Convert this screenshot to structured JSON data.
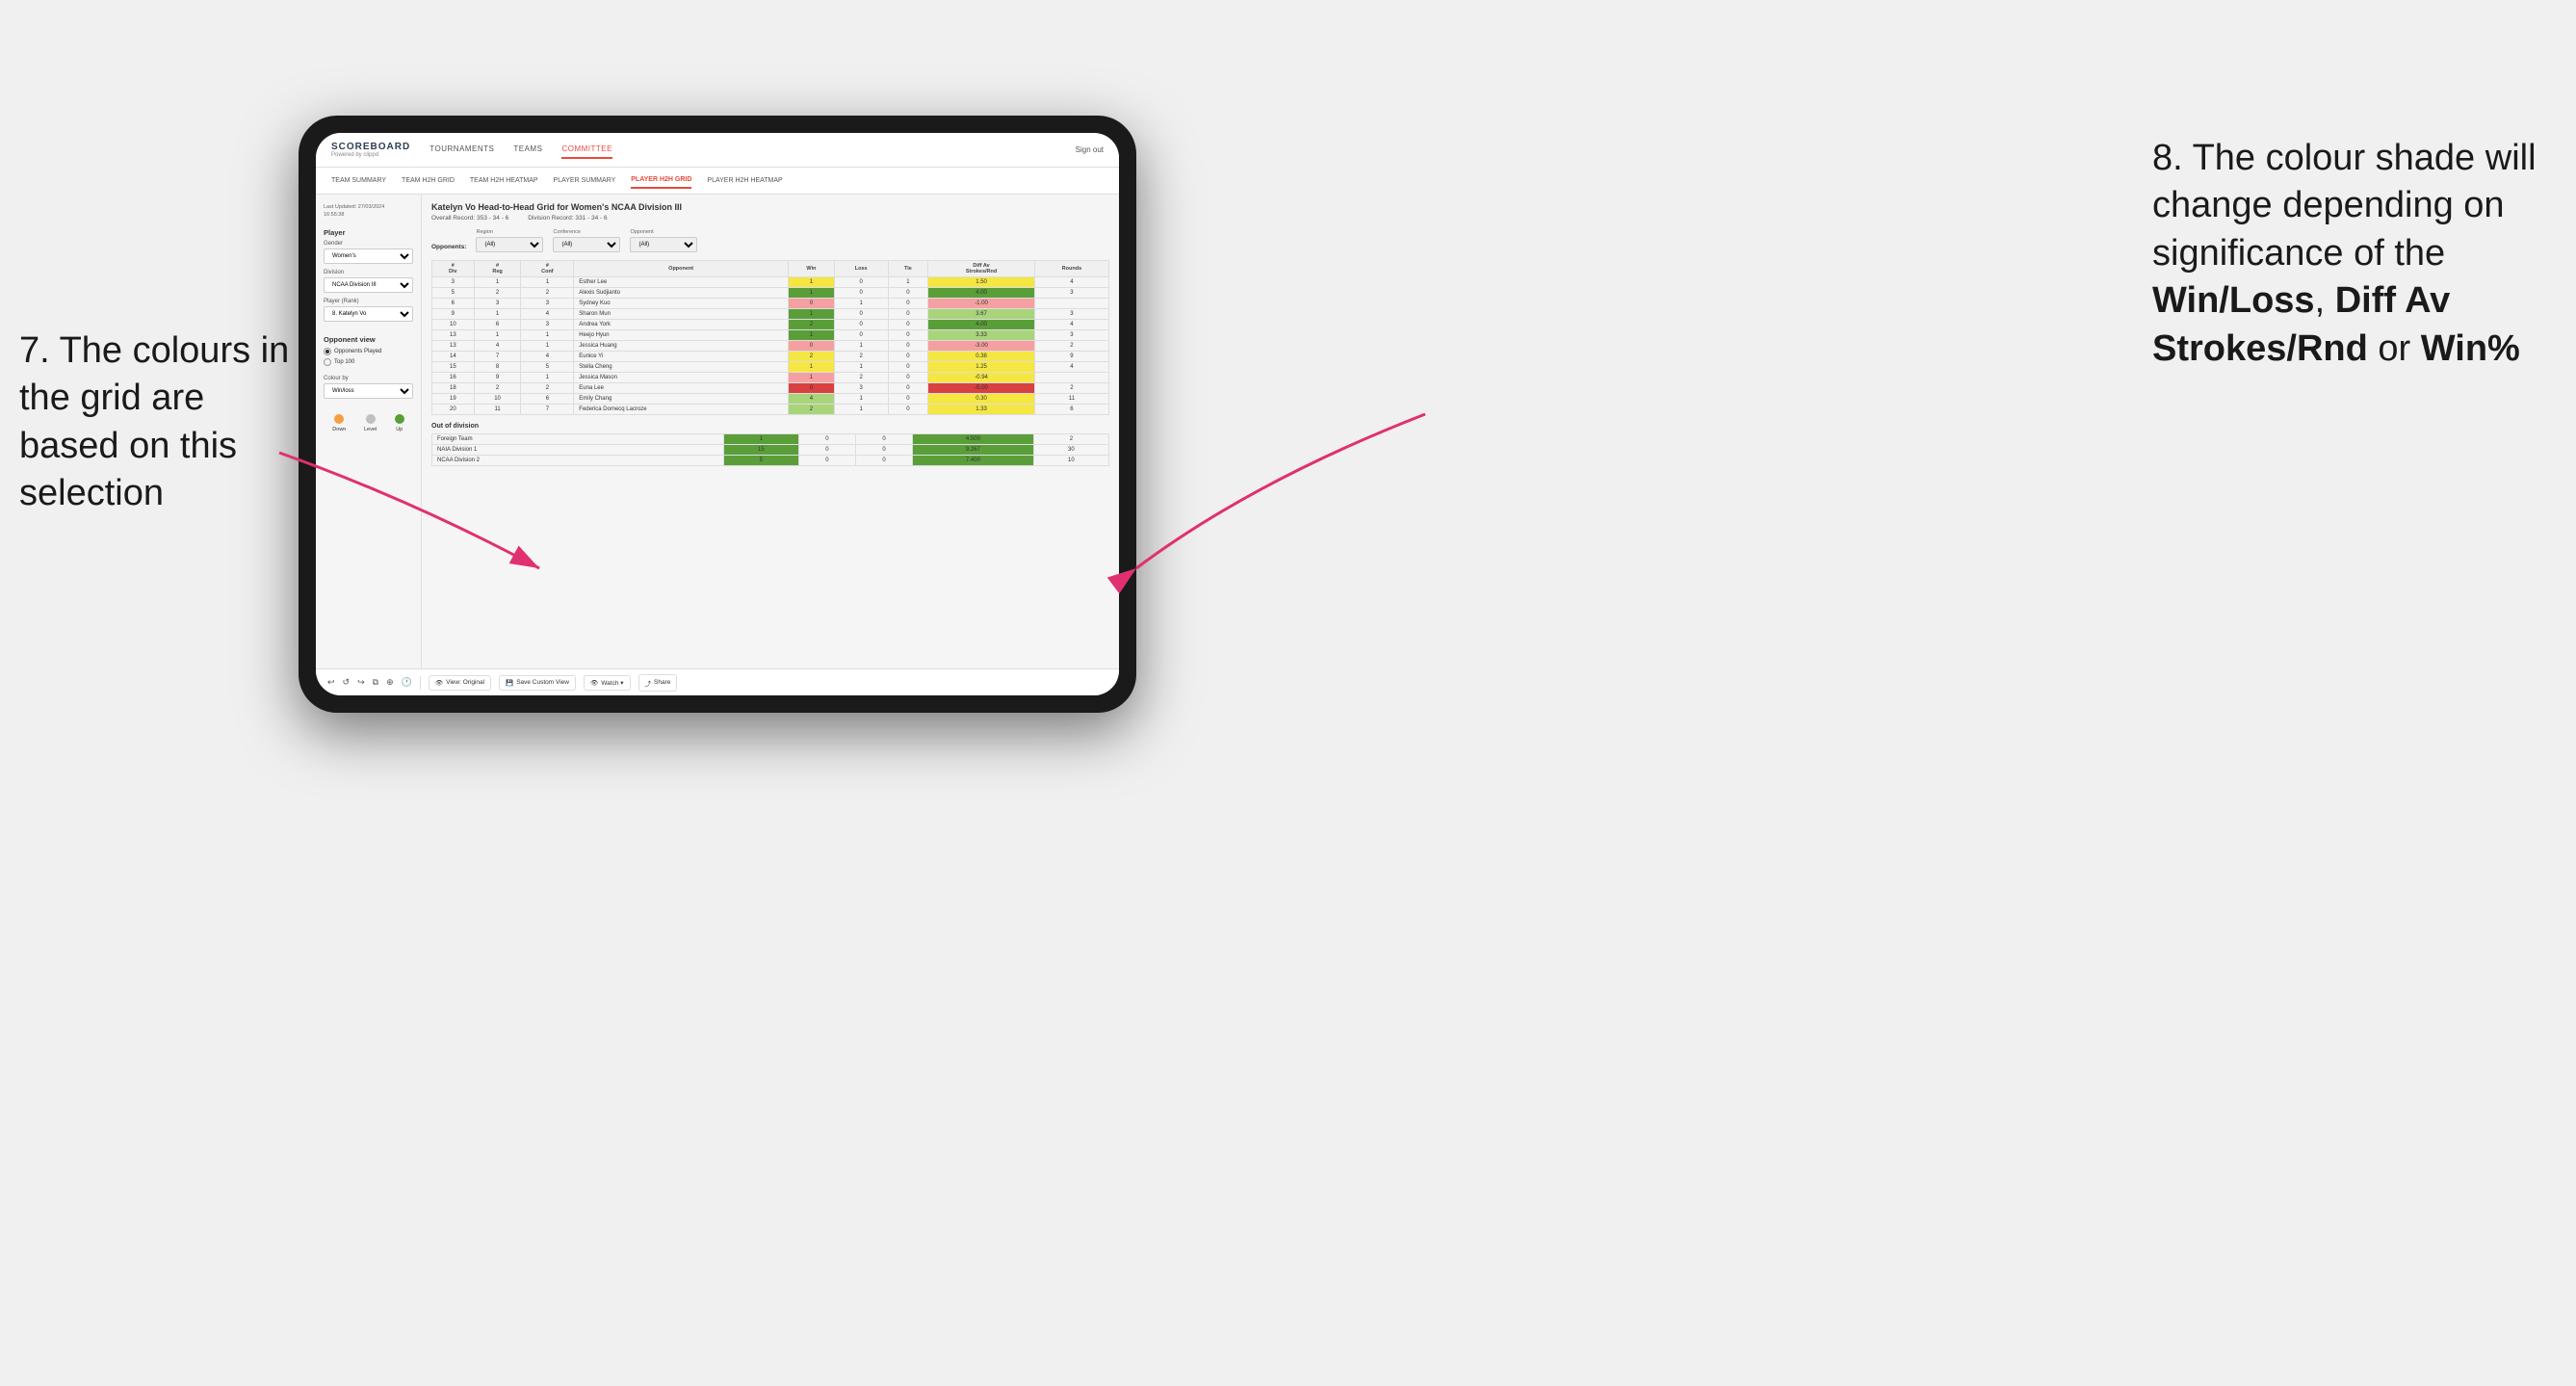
{
  "annotations": {
    "left_text": "7. The colours in the grid are based on this selection",
    "right_text_line1": "8. The colour shade will change depending on significance of the ",
    "right_bold1": "Win/Loss",
    "right_text_line2": ", ",
    "right_bold2": "Diff Av Strokes/Rnd",
    "right_text_line3": " or ",
    "right_bold3": "Win%"
  },
  "nav": {
    "logo": "SCOREBOARD",
    "logo_sub": "Powered by clippd",
    "links": [
      "TOURNAMENTS",
      "TEAMS",
      "COMMITTEE"
    ],
    "right": [
      "Sign out"
    ]
  },
  "sub_nav": {
    "links": [
      "TEAM SUMMARY",
      "TEAM H2H GRID",
      "TEAM H2H HEATMAP",
      "PLAYER SUMMARY",
      "PLAYER H2H GRID",
      "PLAYER H2H HEATMAP"
    ]
  },
  "sidebar": {
    "timestamp": "Last Updated: 27/03/2024\n16:55:38",
    "player_section": "Player",
    "gender_label": "Gender",
    "gender_value": "Women's",
    "division_label": "Division",
    "division_value": "NCAA Division III",
    "player_rank_label": "Player (Rank)",
    "player_rank_value": "8. Katelyn Vo",
    "opponent_view_label": "Opponent view",
    "radio_options": [
      "Opponents Played",
      "Top 100"
    ],
    "colour_by_label": "Colour by",
    "colour_by_value": "Win/loss",
    "legend": [
      {
        "label": "Down",
        "color": "#f5a040"
      },
      {
        "label": "Level",
        "color": "#c0c0c0"
      },
      {
        "label": "Up",
        "color": "#5a9e3a"
      }
    ]
  },
  "grid": {
    "title": "Katelyn Vo Head-to-Head Grid for Women's NCAA Division III",
    "overall_record_label": "Overall Record:",
    "overall_record_value": "353 - 34 - 6",
    "division_record_label": "Division Record:",
    "division_record_value": "331 - 34 - 6",
    "filters": {
      "opponents_label": "Opponents:",
      "region_label": "Region",
      "conference_label": "Conference",
      "opponent_label": "Opponent",
      "region_value": "(All)",
      "conference_value": "(All)",
      "opponent_value": "(All)"
    },
    "table_headers": [
      "#\nDiv",
      "#\nReg",
      "#\nConf",
      "Opponent",
      "Win",
      "Loss",
      "Tie",
      "Diff Av\nStrokes/Rnd",
      "Rounds"
    ],
    "rows": [
      {
        "div": "3",
        "reg": "1",
        "conf": "1",
        "opponent": "Esther Lee",
        "win": "1",
        "loss": "0",
        "tie": "1",
        "diff": "1.50",
        "rounds": "4",
        "win_color": "yellow",
        "diff_color": "yellow"
      },
      {
        "div": "5",
        "reg": "2",
        "conf": "2",
        "opponent": "Alexis Sudjianto",
        "win": "1",
        "loss": "0",
        "tie": "0",
        "diff": "4.00",
        "rounds": "3",
        "win_color": "green_dark",
        "diff_color": "green_dark"
      },
      {
        "div": "6",
        "reg": "3",
        "conf": "3",
        "opponent": "Sydney Kuo",
        "win": "0",
        "loss": "1",
        "tie": "0",
        "diff": "-1.00",
        "rounds": "",
        "win_color": "red_light",
        "diff_color": "red_light"
      },
      {
        "div": "9",
        "reg": "1",
        "conf": "4",
        "opponent": "Sharon Mun",
        "win": "1",
        "loss": "0",
        "tie": "0",
        "diff": "3.67",
        "rounds": "3",
        "win_color": "green_dark",
        "diff_color": "green_light"
      },
      {
        "div": "10",
        "reg": "6",
        "conf": "3",
        "opponent": "Andrea York",
        "win": "2",
        "loss": "0",
        "tie": "0",
        "diff": "4.00",
        "rounds": "4",
        "win_color": "green_dark",
        "diff_color": "green_dark"
      },
      {
        "div": "13",
        "reg": "1",
        "conf": "1",
        "opponent": "Heejo Hyun",
        "win": "1",
        "loss": "0",
        "tie": "0",
        "diff": "3.33",
        "rounds": "3",
        "win_color": "green_dark",
        "diff_color": "green_light"
      },
      {
        "div": "13",
        "reg": "4",
        "conf": "1",
        "opponent": "Jessica Huang",
        "win": "0",
        "loss": "1",
        "tie": "0",
        "diff": "-3.00",
        "rounds": "2",
        "win_color": "red_light",
        "diff_color": "red_light"
      },
      {
        "div": "14",
        "reg": "7",
        "conf": "4",
        "opponent": "Eunice Yi",
        "win": "2",
        "loss": "2",
        "tie": "0",
        "diff": "0.38",
        "rounds": "9",
        "win_color": "yellow",
        "diff_color": "yellow"
      },
      {
        "div": "15",
        "reg": "8",
        "conf": "5",
        "opponent": "Stella Cheng",
        "win": "1",
        "loss": "1",
        "tie": "0",
        "diff": "1.25",
        "rounds": "4",
        "win_color": "yellow",
        "diff_color": "yellow"
      },
      {
        "div": "16",
        "reg": "9",
        "conf": "1",
        "opponent": "Jessica Mason",
        "win": "1",
        "loss": "2",
        "tie": "0",
        "diff": "-0.94",
        "rounds": "",
        "win_color": "red_light",
        "diff_color": "yellow"
      },
      {
        "div": "18",
        "reg": "2",
        "conf": "2",
        "opponent": "Euna Lee",
        "win": "0",
        "loss": "3",
        "tie": "0",
        "diff": "-5.00",
        "rounds": "2",
        "win_color": "red_dark",
        "diff_color": "red_dark"
      },
      {
        "div": "19",
        "reg": "10",
        "conf": "6",
        "opponent": "Emily Chang",
        "win": "4",
        "loss": "1",
        "tie": "0",
        "diff": "0.30",
        "rounds": "11",
        "win_color": "green_light",
        "diff_color": "yellow"
      },
      {
        "div": "20",
        "reg": "11",
        "conf": "7",
        "opponent": "Federica Domecq Lacroze",
        "win": "2",
        "loss": "1",
        "tie": "0",
        "diff": "1.33",
        "rounds": "6",
        "win_color": "green_light",
        "diff_color": "yellow"
      }
    ],
    "out_of_division_title": "Out of division",
    "out_of_division_rows": [
      {
        "opponent": "Foreign Team",
        "win": "1",
        "loss": "0",
        "tie": "0",
        "diff": "4.500",
        "rounds": "2",
        "win_color": "green_dark",
        "diff_color": "green_dark"
      },
      {
        "opponent": "NAIA Division 1",
        "win": "15",
        "loss": "0",
        "tie": "0",
        "diff": "9.267",
        "rounds": "30",
        "win_color": "green_dark",
        "diff_color": "green_dark"
      },
      {
        "opponent": "NCAA Division 2",
        "win": "5",
        "loss": "0",
        "tie": "0",
        "diff": "7.400",
        "rounds": "10",
        "win_color": "green_dark",
        "diff_color": "green_dark"
      }
    ]
  },
  "toolbar": {
    "buttons": [
      "View: Original",
      "Save Custom View",
      "Watch",
      "Share"
    ]
  }
}
